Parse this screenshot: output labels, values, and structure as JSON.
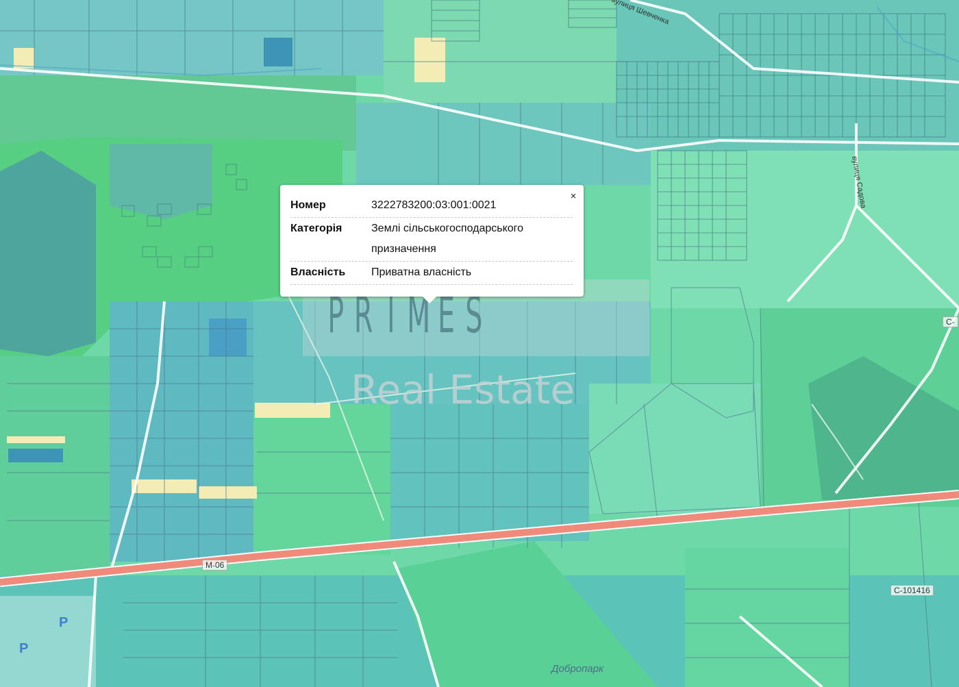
{
  "popup": {
    "close_label": "×",
    "rows": [
      {
        "key": "Номер",
        "value": "3222783200:03:001:0021"
      },
      {
        "key": "Категорія",
        "value": "Землі сільськогосподарського призначення"
      },
      {
        "key": "Власність",
        "value": "Приватна власність"
      }
    ]
  },
  "watermark": {
    "letters": [
      "P",
      "R",
      "I",
      "M",
      "E",
      "S"
    ],
    "subtitle": "Real Estate"
  },
  "map_labels": {
    "road_m06": "М-06",
    "road_c101416": "С-101416",
    "road_c_edge": "С-",
    "street_shevchenka": "вулиця Шевченка",
    "street_vertical": "вулиця Садова",
    "place_dobropark": "Добропарк",
    "parking_1": "P",
    "parking_2": "P"
  },
  "colors": {
    "land_light": "#7ddcb2",
    "land_green": "#56d590",
    "land_blue": "#63c2c4",
    "land_teal": "#5aa7a0",
    "land_yellow": "#f5efb6",
    "road_highway": "#f08a7a",
    "road_minor": "#ffffff",
    "parcel_line": "#4f7d8d"
  }
}
